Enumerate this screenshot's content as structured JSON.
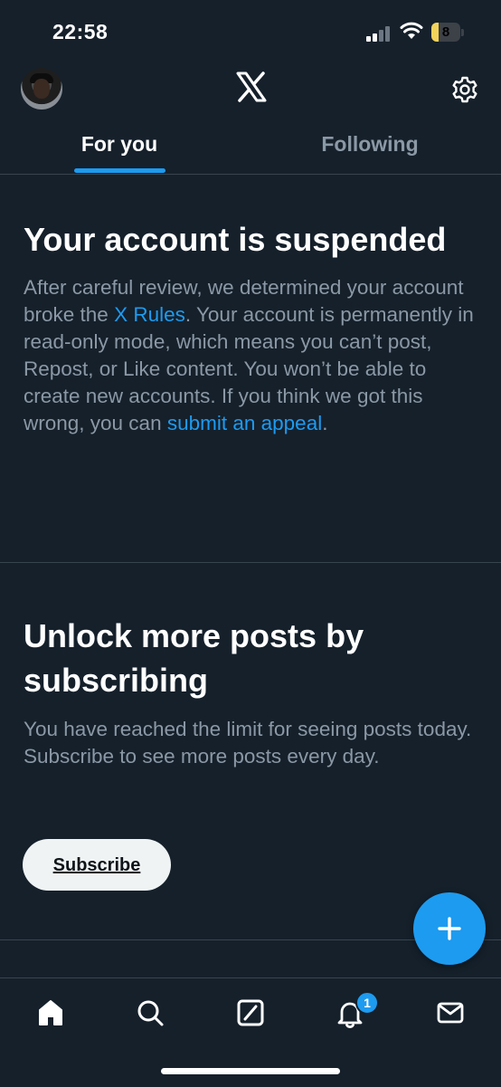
{
  "status_bar": {
    "time": "22:58",
    "battery_level": "8"
  },
  "header": {
    "logo": "x-logo",
    "settings_icon": "gear-icon"
  },
  "tabs": [
    {
      "label": "For you",
      "selected": true
    },
    {
      "label": "Following",
      "selected": false
    }
  ],
  "suspended": {
    "title": "Your account is suspended",
    "body_1": "After careful review, we determined your account broke the ",
    "rules_link": "X Rules",
    "body_2": ". Your account is permanently in read-only mode, which means you can’t post, Repost, or Like content. You won’t be able to create new accounts. If you think we got this wrong, you can ",
    "appeal_link": "submit an appeal",
    "body_3": "."
  },
  "unlock": {
    "title": "Unlock more posts by subscribing",
    "body": "You have reached the limit for seeing posts today. Subscribe to see more posts every day.",
    "button_label": "Subscribe"
  },
  "bottom_nav": {
    "items": [
      "home-icon",
      "search-icon",
      "grok-icon",
      "notifications-icon",
      "messages-icon"
    ],
    "notification_count": "1"
  },
  "colors": {
    "background": "#15202b",
    "accent": "#1d9bf0",
    "secondary_text": "#8b98a5",
    "divider": "#38444d"
  }
}
